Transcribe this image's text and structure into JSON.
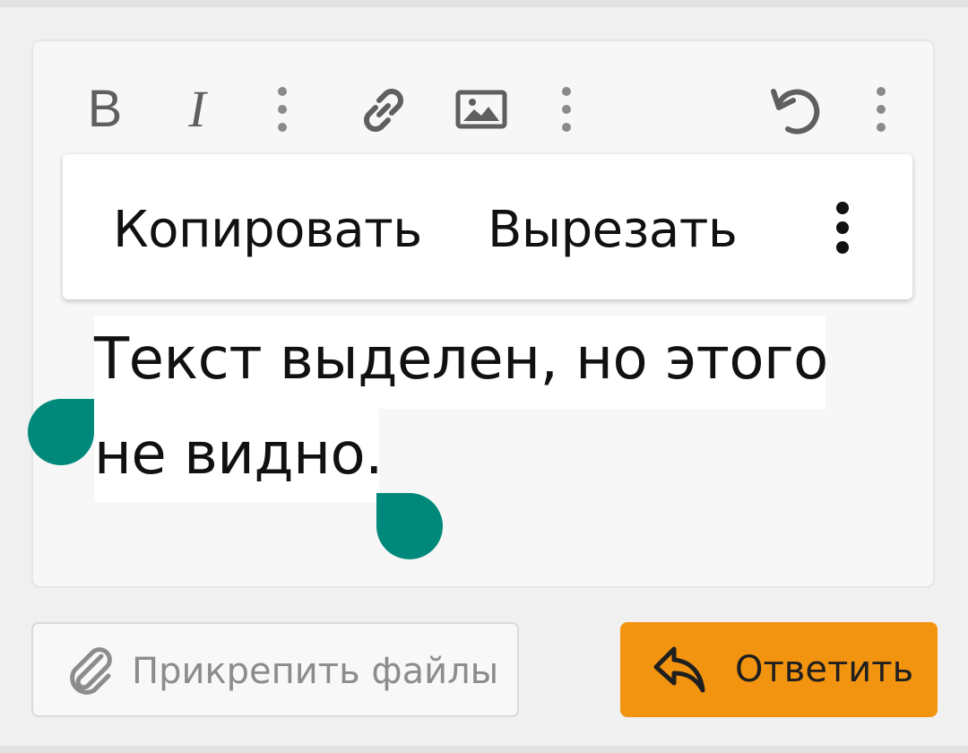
{
  "toolbar": {
    "bold_label": "B",
    "italic_label": "I",
    "icons": [
      "bold-icon",
      "italic-icon",
      "more-vertical-icon",
      "link-icon",
      "image-icon",
      "more-vertical-icon",
      "undo-icon",
      "more-vertical-icon"
    ]
  },
  "context_menu": {
    "copy_label": "Копировать",
    "cut_label": "Вырезать",
    "more_icon": "more-vertical-icon"
  },
  "editor": {
    "line1": "Текст выделен, но этого",
    "line2": "не видно."
  },
  "actions": {
    "attach_label": "Прикрепить файлы",
    "attach_icon": "paperclip-icon",
    "reply_label": "Ответить",
    "reply_icon": "reply-icon"
  },
  "colors": {
    "selection_handle": "#00897b",
    "reply_button": "#f29410"
  }
}
